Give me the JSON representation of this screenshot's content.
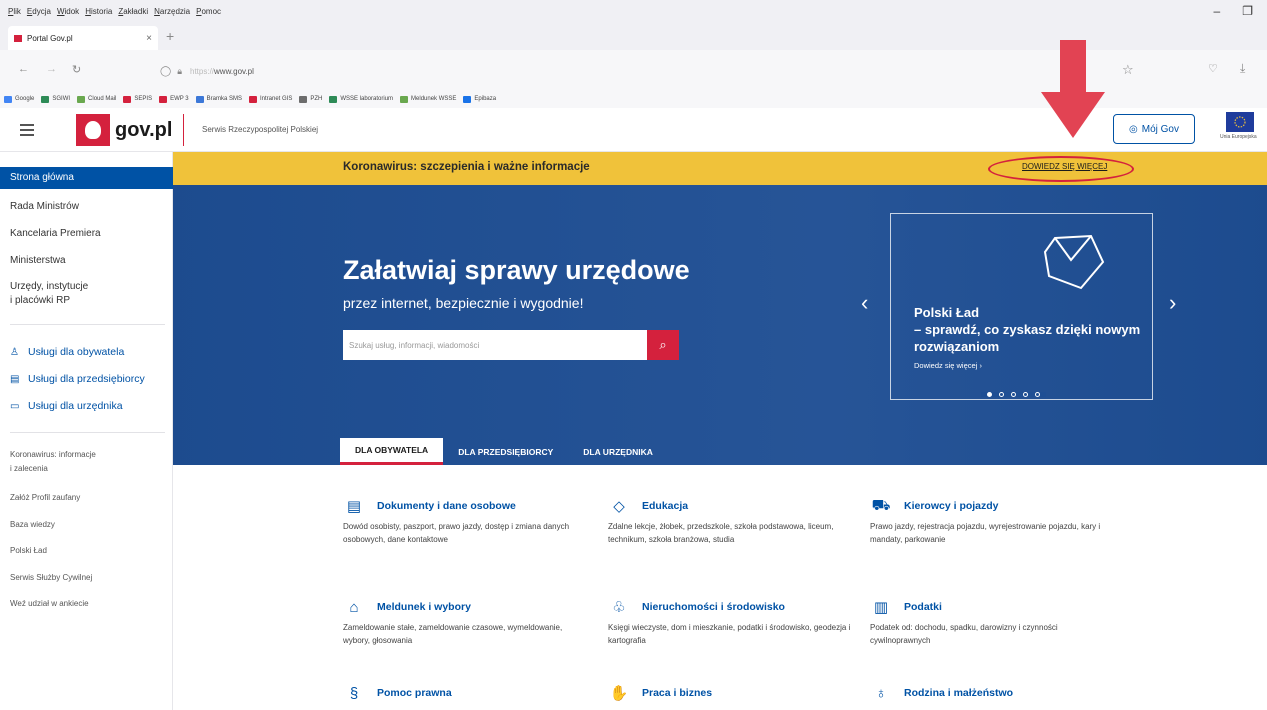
{
  "browser": {
    "menu": [
      "Plik",
      "Edycja",
      "Widok",
      "Historia",
      "Zakładki",
      "Narzędzia",
      "Pomoc"
    ],
    "tab_title": "Portal Gov.pl",
    "tab_close": "×",
    "new_tab": "+",
    "url_prefix": "https://",
    "url_host": "www.gov.pl",
    "bookmarks": [
      {
        "label": "Google",
        "color": "#4285f4"
      },
      {
        "label": "SGIWI",
        "color": "#2e8b57"
      },
      {
        "label": "Cloud Mail",
        "color": "#6aa84f"
      },
      {
        "label": "SEPIS",
        "color": "#d4213d"
      },
      {
        "label": "EWP 3",
        "color": "#d4213d"
      },
      {
        "label": "Bramka SMS",
        "color": "#3c78d8"
      },
      {
        "label": "Intranet GIS",
        "color": "#d4213d"
      },
      {
        "label": "PZH",
        "color": "#6d6d6d"
      },
      {
        "label": "WSSE laboratorium",
        "color": "#2e8b57"
      },
      {
        "label": "Meldunek WSSE",
        "color": "#6aa84f"
      },
      {
        "label": "Epibaza",
        "color": "#1a73e8"
      }
    ]
  },
  "header": {
    "logo_text": "gov.pl",
    "service_name": "Serwis Rzeczypospolitej Polskiej",
    "moj_gov": "Mój Gov",
    "eu_text": "Unia Europejska"
  },
  "sidebar": {
    "main_items": [
      {
        "label": "Strona główna",
        "active": true
      },
      {
        "label": "Rada Ministrów"
      },
      {
        "label": "Kancelaria Premiera"
      },
      {
        "label": "Ministerstwa"
      },
      {
        "label": "Urzędy, instytucje"
      },
      {
        "label": "i placówki RP"
      }
    ],
    "service_items": [
      {
        "label": "Usługi dla obywatela",
        "icon": "person-icon"
      },
      {
        "label": "Usługi dla przedsiębiorcy",
        "icon": "briefcase-icon"
      },
      {
        "label": "Usługi dla urzędnika",
        "icon": "monitor-icon"
      }
    ],
    "extra_items": [
      "Koronawirus: informacje",
      "i zalecenia",
      "Załóż Profil zaufany",
      "Baza wiedzy",
      "Polski Ład",
      "Serwis Służby Cywilnej",
      "Weź udział w ankiecie"
    ]
  },
  "banner": {
    "text": "Koronawirus: szczepienia i ważne informacje",
    "link": "DOWIEDZ SIĘ WIĘCEJ"
  },
  "hero": {
    "title": "Załatwiaj sprawy urzędowe",
    "subtitle": "przez internet, bezpiecznie i wygodnie!",
    "search_placeholder": "Szukaj usług, informacji, wiadomości",
    "promo_line1": "Polski Ład",
    "promo_line2": "– sprawdź, co zyskasz dzięki nowym rozwiązaniom",
    "promo_more": "Dowiedz się więcej ›",
    "active_slide": 1,
    "slide_count": 5
  },
  "tabs": [
    "DLA OBYWATELA",
    "DLA PRZEDSIĘBIORCY",
    "DLA URZĘDNIKA"
  ],
  "categories": [
    {
      "title": "Dokumenty i dane osobowe",
      "desc": "Dowód osobisty, paszport, prawo jazdy, dostęp i zmiana danych osobowych, dane kontaktowe",
      "icon": "id-card-icon",
      "glyph": "▤"
    },
    {
      "title": "Edukacja",
      "desc": "Zdalne lekcje, żłobek, przedszkole, szkoła podstawowa, liceum, technikum, szkoła branżowa, studia",
      "icon": "graduation-cap-icon",
      "glyph": "◇"
    },
    {
      "title": "Kierowcy i pojazdy",
      "desc": "Prawo jazdy, rejestracja pojazdu, wyrejestrowanie pojazdu, kary i mandaty, parkowanie",
      "icon": "car-icon",
      "glyph": "⛟"
    },
    {
      "title": "Meldunek i wybory",
      "desc": "Zameldowanie stałe, zameldowanie czasowe, wymeldowanie, wybory, głosowania",
      "icon": "house-icon",
      "glyph": "⌂"
    },
    {
      "title": "Nieruchomości i środowisko",
      "desc": "Księgi wieczyste, dom i mieszkanie, podatki i środowisko, geodezja i kartografia",
      "icon": "tree-building-icon",
      "glyph": "♧"
    },
    {
      "title": "Podatki",
      "desc": "Podatek od: dochodu, spadku, darowizny i czynności cywilnoprawnych",
      "icon": "tax-document-icon",
      "glyph": "▥"
    },
    {
      "title": "Pomoc prawna",
      "desc": "",
      "icon": "paragraph-icon",
      "glyph": "§"
    },
    {
      "title": "Praca i biznes",
      "desc": "",
      "icon": "handshake-icon",
      "glyph": "✋"
    },
    {
      "title": "Rodzina i małżeństwo",
      "desc": "",
      "icon": "family-icon",
      "glyph": "♁"
    }
  ]
}
